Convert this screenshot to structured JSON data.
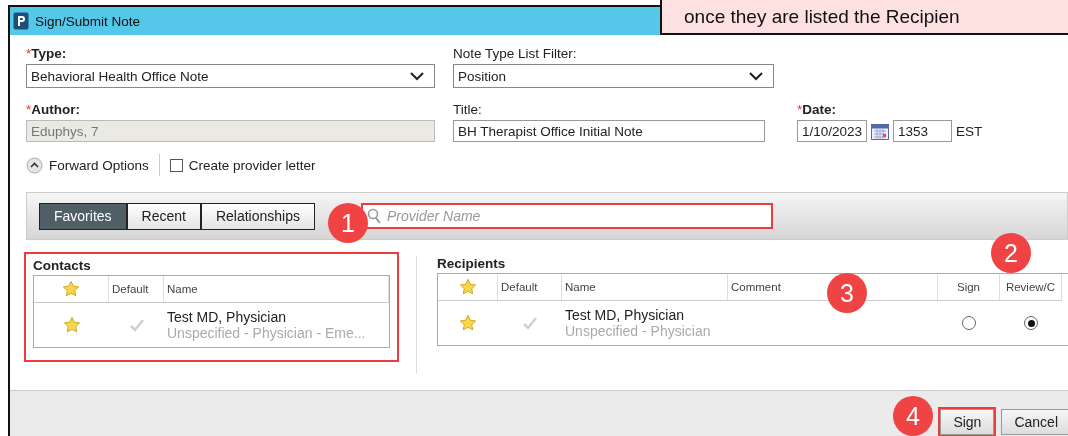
{
  "window": {
    "title": "Sign/Submit Note"
  },
  "callout": {
    "text": "once they are listed the Recipien"
  },
  "form": {
    "type": {
      "label": "Type:",
      "required_mark": "*",
      "value": "Behavioral Health Office Note"
    },
    "note_type_filter": {
      "label": "Note Type List Filter:",
      "value": "Position"
    },
    "author": {
      "label": "Author:",
      "required_mark": "*",
      "value": "Eduphys, 7",
      "disabled": true
    },
    "title": {
      "label": "Title:",
      "value": "BH Therapist Office Initial Note"
    },
    "date": {
      "label": "Date:",
      "required_mark": "*",
      "value": "1/10/2023",
      "time": "1353",
      "zone": "EST"
    }
  },
  "forward_options": {
    "label": "Forward Options",
    "expanded": true
  },
  "create_letter": {
    "label": "Create provider letter",
    "checked": false
  },
  "tabs": [
    {
      "label": "Favorites",
      "selected": true
    },
    {
      "label": "Recent",
      "selected": false
    },
    {
      "label": "Relationships",
      "selected": false
    }
  ],
  "search": {
    "placeholder": "Provider Name",
    "highlighted": true
  },
  "contacts": {
    "title": "Contacts",
    "highlighted": true,
    "columns": [
      "Default",
      "Name"
    ],
    "rows": [
      {
        "favorite": true,
        "default": false,
        "name": "Test MD, Physician",
        "detail": "Unspecified - Physician - Eme..."
      }
    ]
  },
  "recipients": {
    "title": "Recipients",
    "columns": [
      "Default",
      "Name",
      "Comment",
      "Sign",
      "Review/C"
    ],
    "rows": [
      {
        "favorite": true,
        "default": false,
        "name": "Test MD, Physician",
        "detail": "Unspecified - Physician",
        "sign": false,
        "review": true
      }
    ]
  },
  "buttons": [
    {
      "label": "Sign",
      "highlighted": true
    },
    {
      "label": "Cancel",
      "highlighted": false
    }
  ],
  "badges": [
    "1",
    "2",
    "3",
    "4"
  ]
}
